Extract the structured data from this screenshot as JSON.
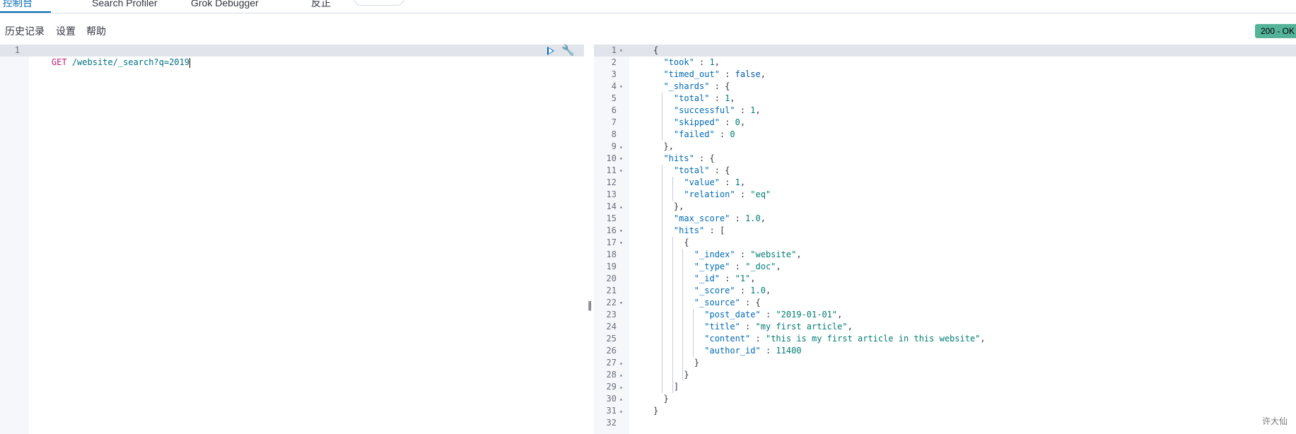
{
  "top_tabs": [
    {
      "label": "控制台",
      "active": true
    },
    {
      "label": "Search Profiler",
      "active": false
    },
    {
      "label": "Grok Debugger",
      "active": false
    },
    {
      "label": "反正",
      "active": false
    }
  ],
  "menu": {
    "history": "历史记录",
    "settings": "设置",
    "help": "帮助"
  },
  "status": {
    "text": "200 - OK",
    "color": "#54b399"
  },
  "request": {
    "line_number": "1",
    "method": "GET",
    "url": " /website/_search?q=2019"
  },
  "response_lines": [
    "{",
    "  \"took\" : 1,",
    "  \"timed_out\" : false,",
    "  \"_shards\" : {",
    "    \"total\" : 1,",
    "    \"successful\" : 1,",
    "    \"skipped\" : 0,",
    "    \"failed\" : 0",
    "  },",
    "  \"hits\" : {",
    "    \"total\" : {",
    "      \"value\" : 1,",
    "      \"relation\" : \"eq\"",
    "    },",
    "    \"max_score\" : 1.0,",
    "    \"hits\" : [",
    "      {",
    "        \"_index\" : \"website\",",
    "        \"_type\" : \"_doc\",",
    "        \"_id\" : \"1\",",
    "        \"_score\" : 1.0,",
    "        \"_source\" : {",
    "          \"post_date\" : \"2019-01-01\",",
    "          \"title\" : \"my first article\",",
    "          \"content\" : \"this is my first article in this website\",",
    "          \"author_id\" : 11400",
    "        }",
    "      }",
    "    ]",
    "  }",
    "}",
    ""
  ],
  "fold_markers": {
    "1": "down",
    "4": "down",
    "9": "up",
    "10": "down",
    "11": "down",
    "14": "up",
    "16": "down",
    "17": "down",
    "22": "down",
    "27": "up",
    "28": "up",
    "29": "up",
    "30": "up",
    "31": "up"
  },
  "icons": {
    "play": "play-icon",
    "wrench": "wrench-icon",
    "divider": "drag-handle-icon"
  },
  "watermark": "许大仙"
}
